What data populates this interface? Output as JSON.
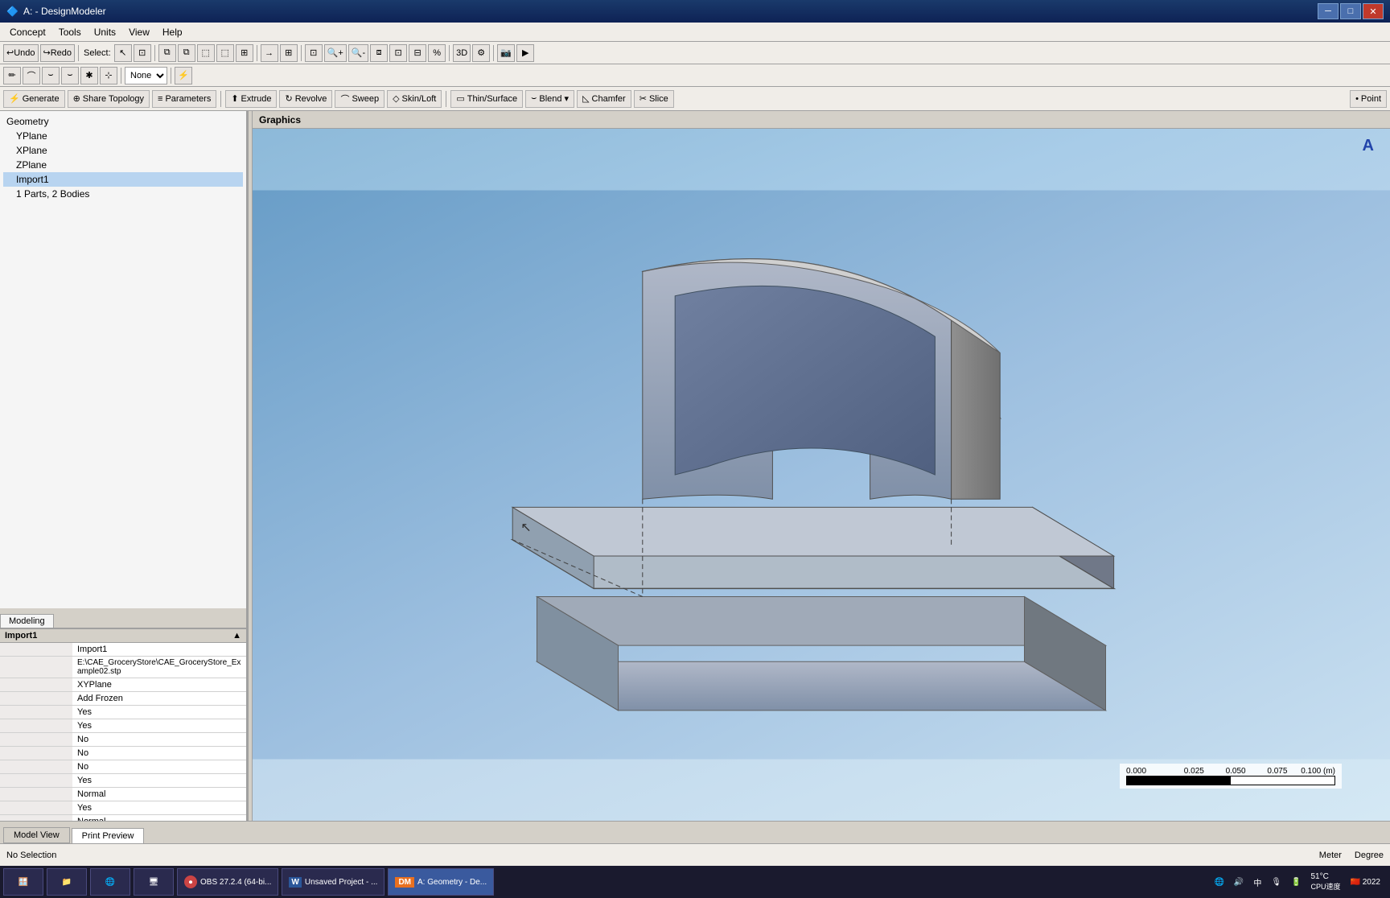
{
  "titlebar": {
    "title": "A: - DesignModeler",
    "min_label": "─",
    "max_label": "□",
    "close_label": "✕"
  },
  "menubar": {
    "items": [
      "Concept",
      "Tools",
      "Units",
      "View",
      "Help"
    ]
  },
  "toolbar1": {
    "undo_label": "Undo",
    "redo_label": "Redo",
    "select_label": "Select:",
    "none_label": "None"
  },
  "toolbar3": {
    "generate_label": "Generate",
    "share_topology_label": "Share Topology",
    "parameters_label": "Parameters",
    "extrude_label": "Extrude",
    "revolve_label": "Revolve",
    "sweep_label": "Sweep",
    "skin_loft_label": "Skin/Loft",
    "thin_surface_label": "Thin/Surface",
    "blend_label": "Blend",
    "chamfer_label": "Chamfer",
    "slice_label": "Slice",
    "point_label": "Point"
  },
  "graphics_header": {
    "title": "Graphics"
  },
  "tree": {
    "items": [
      {
        "label": "Geometry",
        "indent": 0
      },
      {
        "label": "YPlane",
        "indent": 1
      },
      {
        "label": "XPlane",
        "indent": 1
      },
      {
        "label": "ZPlane",
        "indent": 1
      },
      {
        "label": "Import1",
        "indent": 1
      },
      {
        "label": "1 Parts, 2 Bodies",
        "indent": 1
      }
    ]
  },
  "panel_tabs": {
    "tabs": [
      "Modeling"
    ]
  },
  "properties": {
    "header": "Import1",
    "rows": [
      {
        "key": "",
        "value": "Import1"
      },
      {
        "key": "",
        "value": "E:\\CAE_GroceryStore\\CAE_GroceryStore_Example02.stp"
      },
      {
        "key": "",
        "value": "XYPlane"
      },
      {
        "key": "",
        "value": "Add Frozen"
      },
      {
        "key": "",
        "value": "Yes"
      },
      {
        "key": "",
        "value": "Yes"
      },
      {
        "key": "",
        "value": "No"
      },
      {
        "key": "",
        "value": "No"
      },
      {
        "key": "",
        "value": "No"
      },
      {
        "key": "",
        "value": "Yes"
      },
      {
        "key": "",
        "value": "Normal"
      },
      {
        "key": "",
        "value": "Yes"
      },
      {
        "key": "",
        "value": "Normal"
      }
    ]
  },
  "scale_bar": {
    "label_left": "0.000",
    "label_mid1": "0.025",
    "label_mid2": "0.050",
    "label_mid3": "0.075",
    "label_right": "0.100 (m)"
  },
  "triad": {
    "label": "A"
  },
  "bottom_tabs": {
    "tabs": [
      "Model View",
      "Print Preview"
    ]
  },
  "statusbar": {
    "selection": "No Selection",
    "unit_label": "Meter",
    "degree_label": "Degree"
  },
  "taskbar": {
    "start_icon": "🪟",
    "items": [
      {
        "label": "File Manager",
        "icon": "📁"
      },
      {
        "label": "Browser",
        "icon": "🌐"
      },
      {
        "label": "OBS 27.2.4 (64-bi...",
        "icon": "⏺"
      },
      {
        "label": "Unsaved Project - ...",
        "icon": "🔵"
      },
      {
        "label": "DM A: Geometry - De...",
        "icon": "DM",
        "active": true
      }
    ],
    "time": "51°C",
    "cpu_label": "CPU速度",
    "clock": "2022"
  }
}
